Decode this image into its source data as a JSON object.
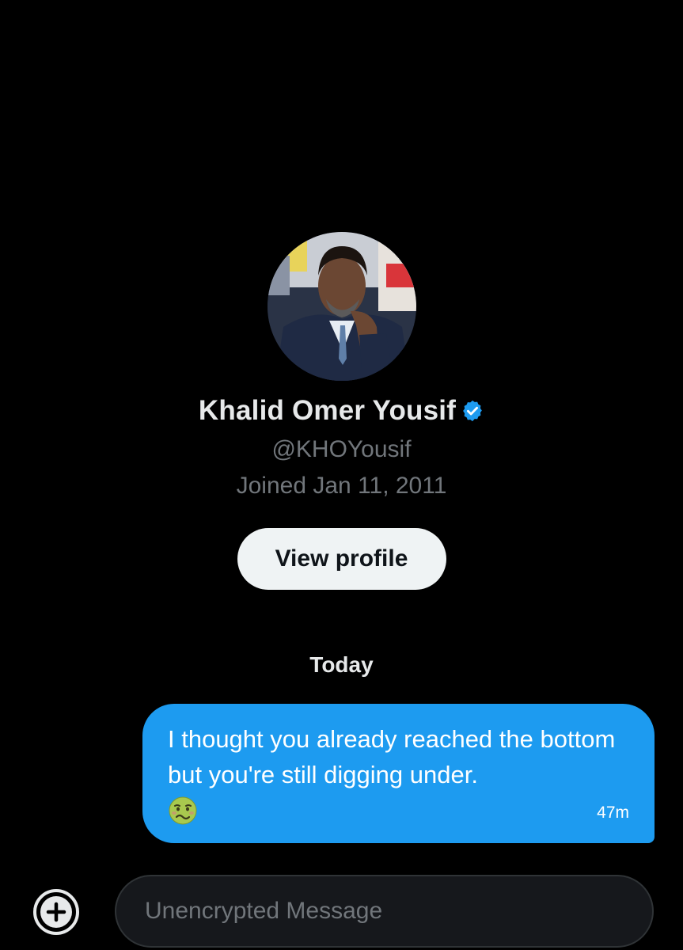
{
  "profile": {
    "name": "Khalid Omer Yousif",
    "handle": "@KHOYousif",
    "joined": "Joined Jan 11, 2011",
    "verified": true,
    "view_profile_label": "View profile"
  },
  "conversation": {
    "day_label": "Today",
    "messages": [
      {
        "text": "I thought you already reached the bottom but you're still digging under.",
        "emoji": "nauseated-face",
        "time": "47m",
        "direction": "outgoing"
      }
    ]
  },
  "composer": {
    "placeholder": "Unencrypted Message",
    "add_icon": "plus-circle-icon"
  },
  "colors": {
    "background": "#000000",
    "bubble": "#1d9bf0",
    "verified": "#1d9bf0",
    "muted_text": "#71767b",
    "button_bg": "#eff3f4"
  }
}
